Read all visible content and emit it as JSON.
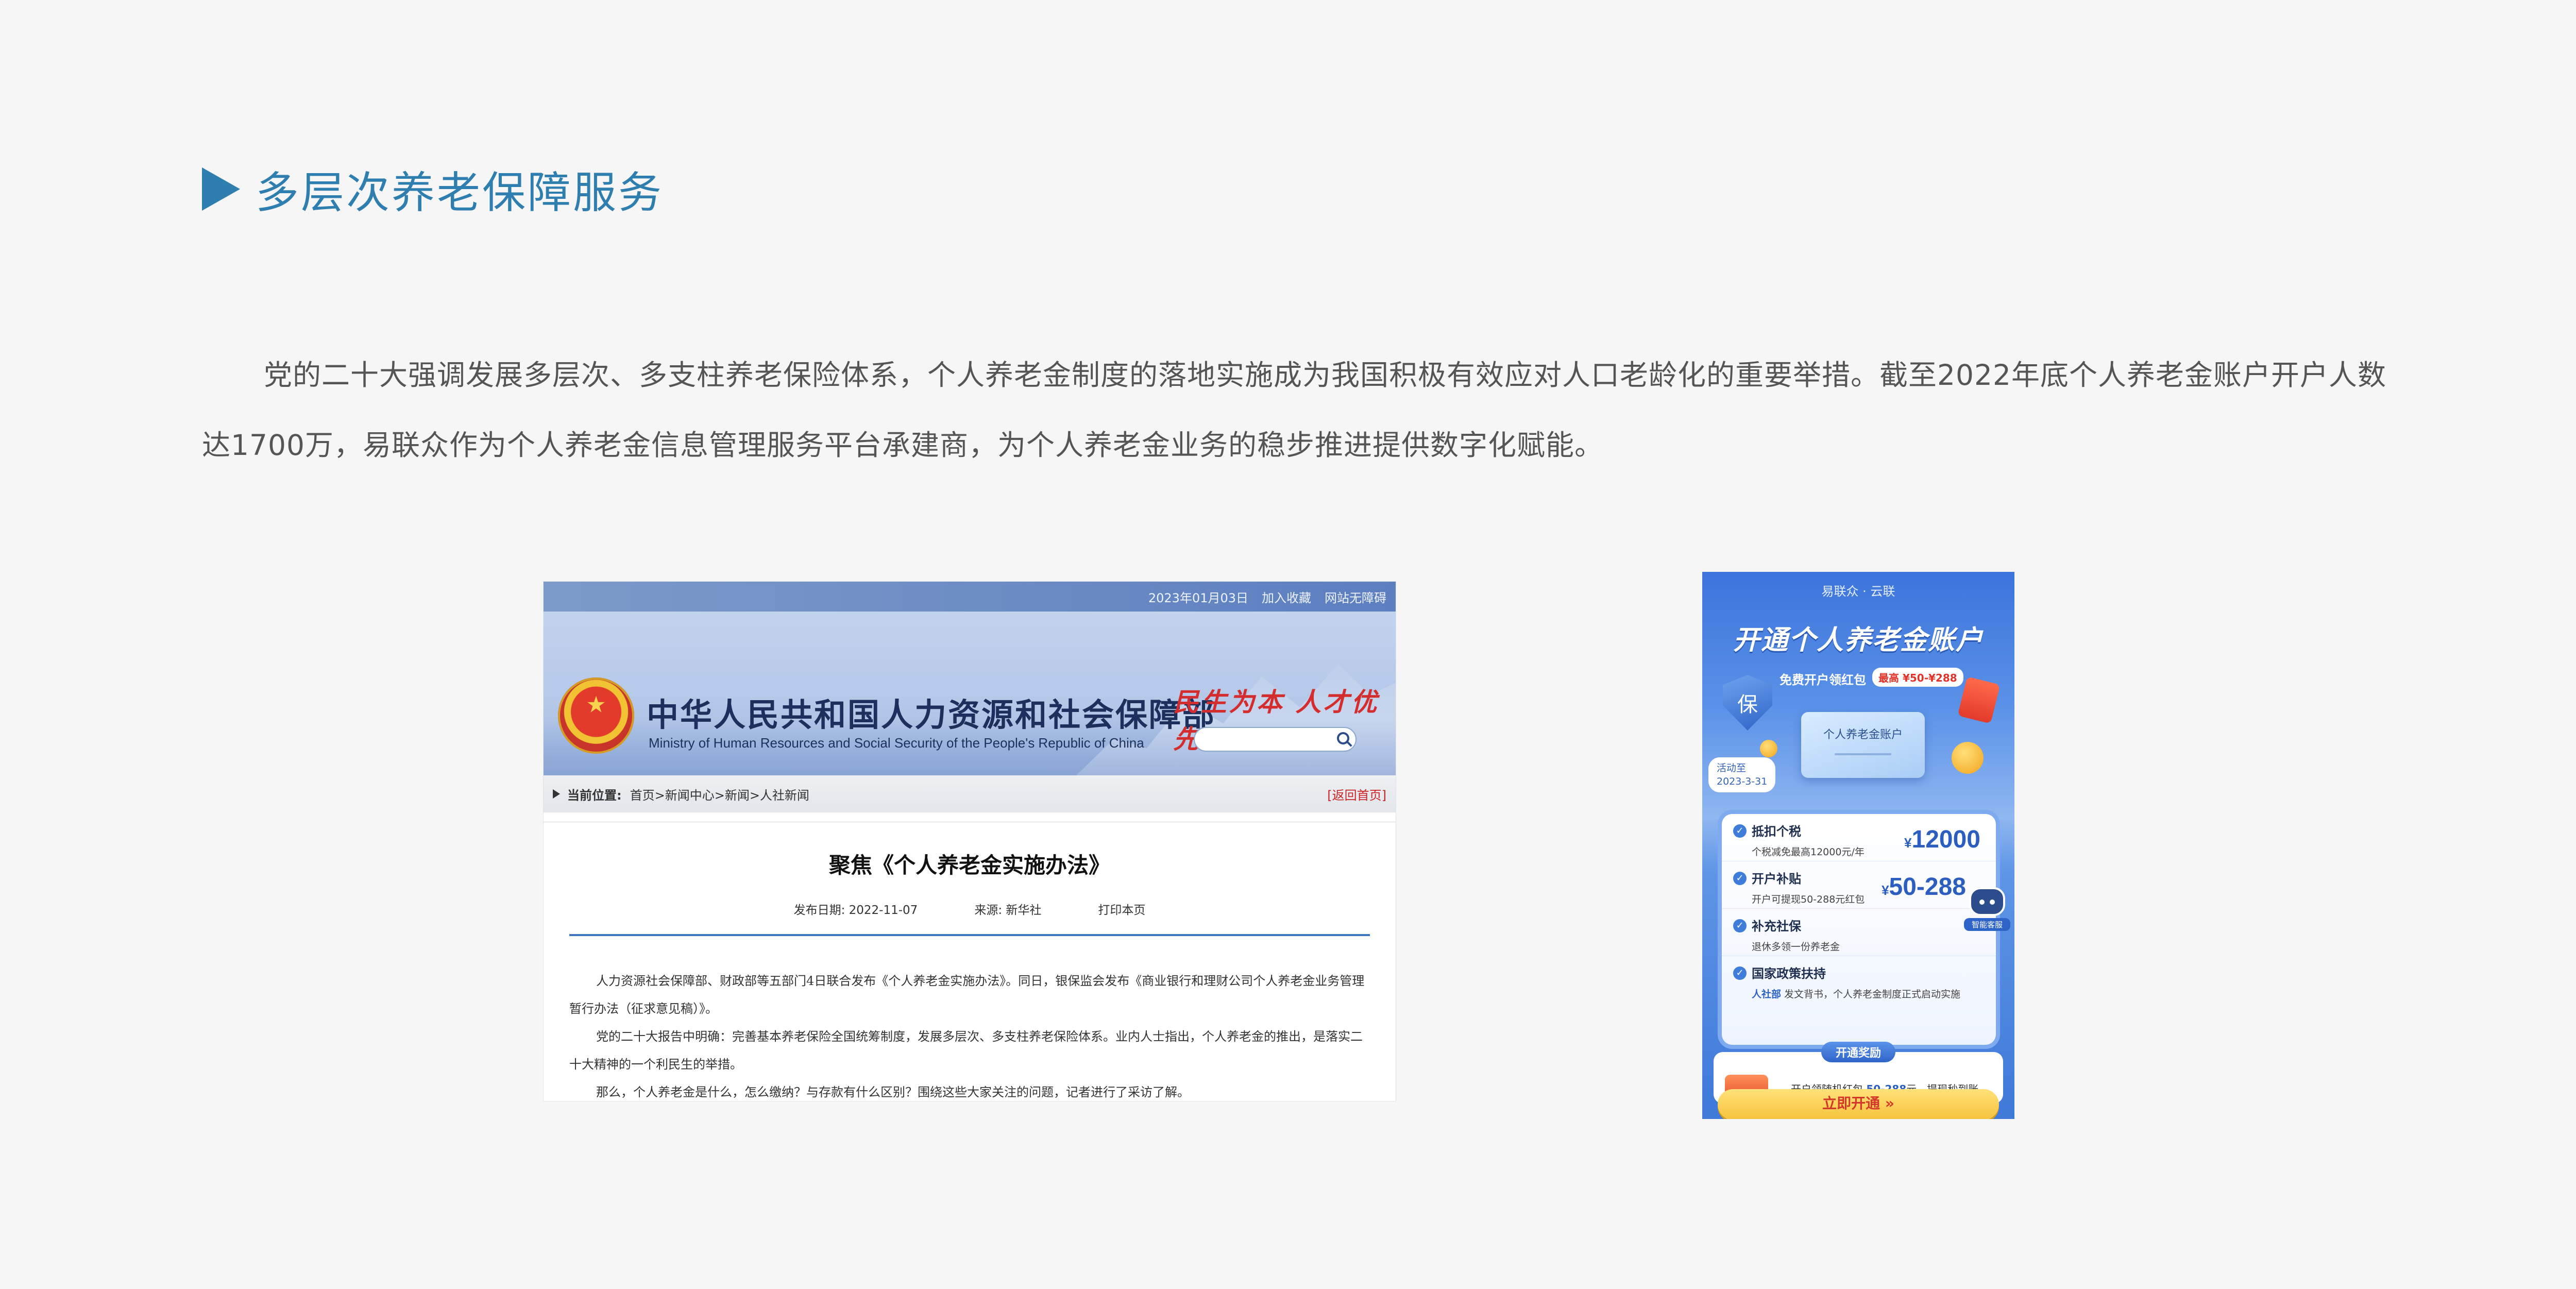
{
  "section": {
    "title": "多层次养老保障服务",
    "intro": "党的二十大强调发展多层次、多支柱养老保险体系，个人养老金制度的落地实施成为我国积极有效应对人口老龄化的重要举措。截至2022年底个人养老金账户开户人数达1700万，易联众作为个人养老金信息管理服务平台承建商，为个人养老金业务的稳步推进提供数字化赋能。"
  },
  "ministry_site": {
    "top_date": "2023年01月03日",
    "top_links": [
      "加入收藏",
      "网站无障碍"
    ],
    "name_cn": "中华人民共和国人力资源和社会保障部",
    "name_en": "Ministry of Human Resources and Social Security of the People's Republic of China",
    "slogan": "民生为本 人才优先",
    "breadcrumb_label": "当前位置:",
    "breadcrumb": "首页>新闻中心>新闻>人社新闻",
    "back_link": "[返回首页]",
    "article": {
      "title": "聚焦《个人养老金实施办法》",
      "date": "发布日期:   2022-11-07",
      "source": "来源:   新华社",
      "print": "打印本页",
      "paragraphs": [
        "人力资源社会保障部、财政部等五部门4日联合发布《个人养老金实施办法》。同日，银保监会发布《商业银行和理财公司个人养老金业务管理暂行办法（征求意见稿）》。",
        "党的二十大报告中明确：完善基本养老保险全国统筹制度，发展多层次、多支柱养老保险体系。业内人士指出，个人养老金的推出，是落实二十大精神的一个利民生的举措。",
        "那么，个人养老金是什么，怎么缴纳？与存款有什么区别？围绕这些大家关注的问题，记者进行了采访了解。"
      ]
    }
  },
  "phone_promo": {
    "logo": "易联众 · 云联",
    "title": "开通个人养老金账户",
    "subtitle": "免费开户领红包",
    "badge": "最高 ¥50-¥288",
    "shield_char": "保",
    "card_label": "个人养老金账户",
    "activity_label": "活动至",
    "activity_date": "2023-3-31",
    "benefits": [
      {
        "title": "抵扣个税",
        "desc": "个税减免最高12000元/年",
        "value_prefix": "¥",
        "value": "12000"
      },
      {
        "title": "开户补贴",
        "desc": "开户可提现50-288元红包",
        "value_prefix": "¥",
        "value": "50-288"
      },
      {
        "title": "补充社保",
        "desc": "退休多领一份养老金",
        "value_prefix": "",
        "value": ""
      },
      {
        "title": "国家政策扶持",
        "desc_strong": "人社部",
        "desc": " 发文背书，个人养老金制度正式启动实施",
        "value_prefix": "",
        "value": ""
      }
    ],
    "assistant_label": "智能客服",
    "reward_tag": "开通奖励",
    "reward_text_pre": "开户领随机红包 ",
    "reward_text_amount": "50-288",
    "reward_text_post": "元，提现秒到账",
    "cta": "立即开通 »"
  }
}
